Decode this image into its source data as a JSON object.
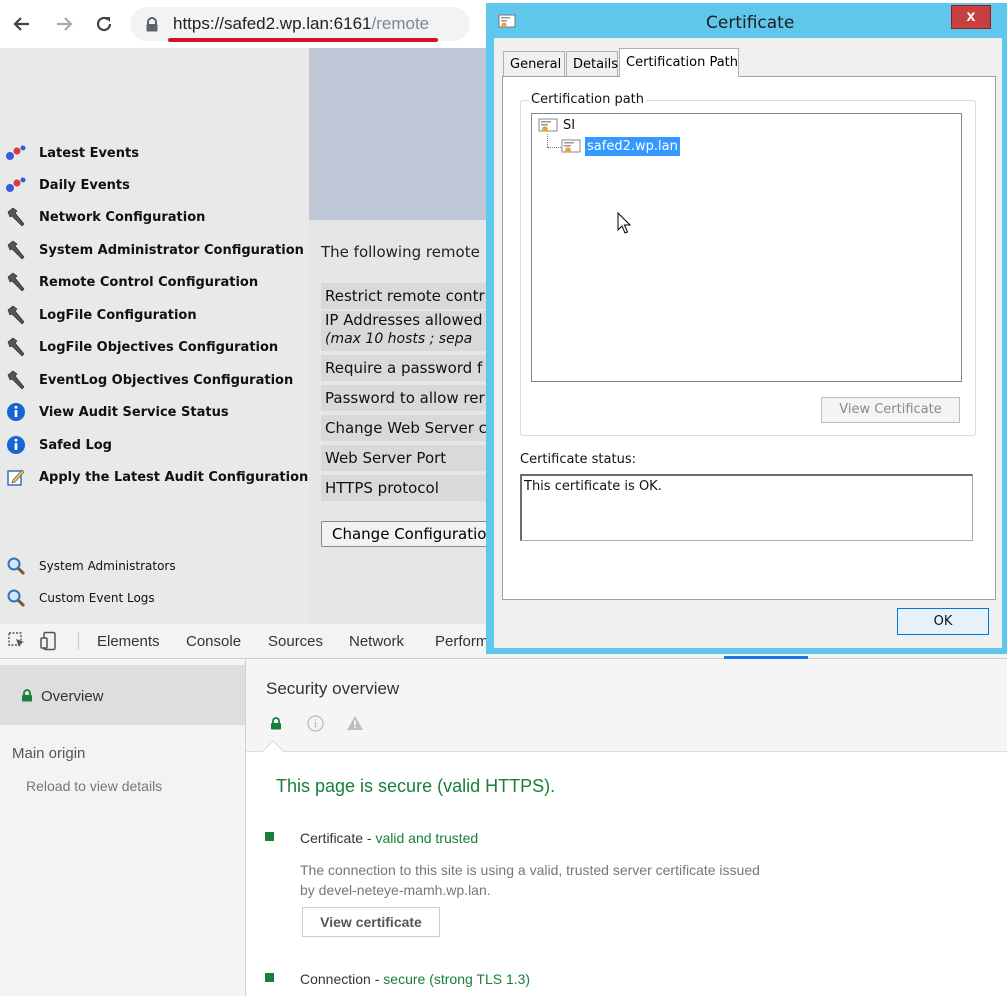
{
  "browser": {
    "url_host": "https://safed2.wp.lan:6161",
    "url_path": "/remote"
  },
  "sidebar": {
    "items": [
      {
        "label": "Latest Events",
        "icon": "events-icon"
      },
      {
        "label": "Daily Events",
        "icon": "events-icon"
      },
      {
        "label": "Network Configuration",
        "icon": "hammer-icon"
      },
      {
        "label": "System Administrator Configuration",
        "icon": "hammer-icon"
      },
      {
        "label": "Remote Control Configuration",
        "icon": "hammer-icon"
      },
      {
        "label": "LogFile Configuration",
        "icon": "hammer-icon"
      },
      {
        "label": "LogFile Objectives Configuration",
        "icon": "hammer-icon"
      },
      {
        "label": "EventLog Objectives Configuration",
        "icon": "hammer-icon"
      },
      {
        "label": "View Audit Service Status",
        "icon": "info-icon"
      },
      {
        "label": "Safed Log",
        "icon": "info-icon"
      },
      {
        "label": "Apply the Latest Audit Configuration",
        "icon": "edit-icon"
      }
    ],
    "secondary": [
      {
        "label": "System Administrators",
        "icon": "magnifier-icon"
      },
      {
        "label": "Custom Event Logs",
        "icon": "magnifier-icon"
      }
    ]
  },
  "content": {
    "intro": "The following remote",
    "rows": [
      {
        "label": "Restrict remote contr"
      },
      {
        "label": "IP Addresses allowed",
        "sub": "(max 10 hosts ; sepa"
      },
      {
        "label": "Require a password f"
      },
      {
        "label": "Password to allow rer"
      },
      {
        "label": "Change Web Server c"
      },
      {
        "label": "Web Server Port"
      },
      {
        "label": "HTTPS protocol"
      }
    ],
    "change_button": "Change Configuration"
  },
  "devtools": {
    "tabs": [
      "Elements",
      "Console",
      "Sources",
      "Network",
      "Perform"
    ],
    "left": {
      "overview": "Overview",
      "main_origin": "Main origin",
      "reload": "Reload to view details"
    },
    "security": {
      "title": "Security overview",
      "headline": "This page is secure (valid HTTPS).",
      "cert_label": "Certificate",
      "cert_sep": " - ",
      "cert_value": "valid and trusted",
      "cert_desc_1": "The connection to this site is using a valid, trusted server certificate issued",
      "cert_desc_2": "by devel-neteye-mamh.wp.lan.",
      "view_cert_button": "View certificate",
      "conn_label": "Connection",
      "conn_sep": " - ",
      "conn_value": "secure (strong TLS 1.3)"
    }
  },
  "dialog": {
    "title": "Certificate",
    "close": "x",
    "tabs": [
      "General",
      "Details",
      "Certification Path"
    ],
    "active_tab": "Certification Path",
    "group_label": "Certification path",
    "tree": [
      {
        "label": "SI",
        "level": 0
      },
      {
        "label": "safed2.wp.lan",
        "level": 1,
        "selected": true
      }
    ],
    "view_button": "View Certificate",
    "status_label": "Certificate status:",
    "status_text": "This certificate is OK.",
    "ok_button": "OK"
  },
  "colors": {
    "secure_green": "#188038",
    "url_underline": "#d6112a",
    "dialog_frame": "#5fc7ec",
    "selection": "#3399ff"
  }
}
